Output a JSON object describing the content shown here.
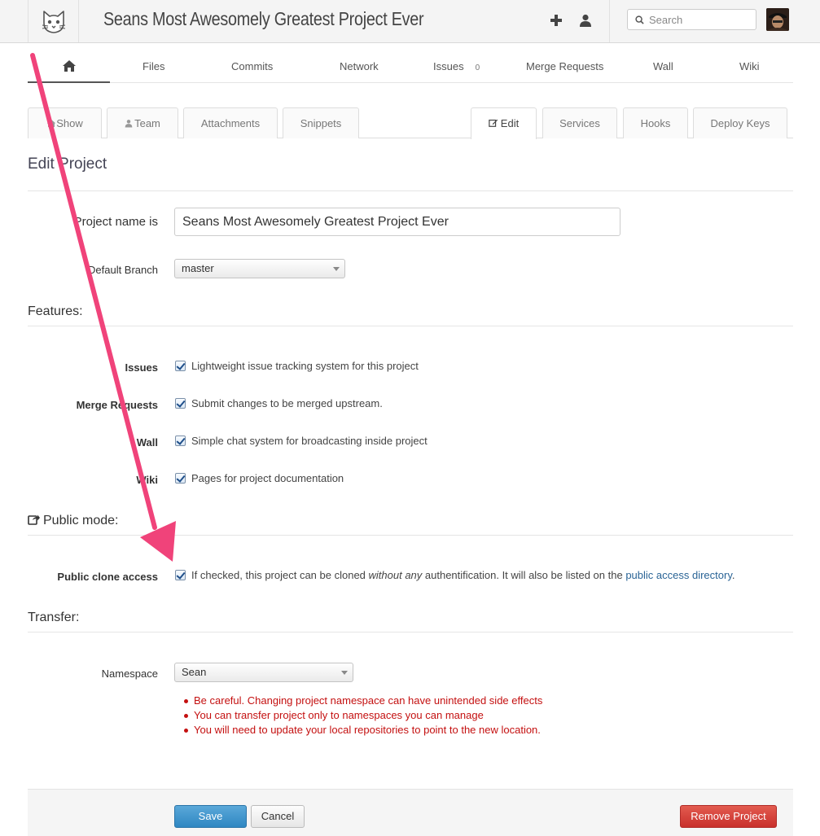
{
  "header": {
    "project_title": "Seans Most Awesomely Greatest Project Ever",
    "search_placeholder": "Search",
    "icons": [
      "gitlab-logo",
      "plus-icon",
      "user-icon",
      "search-icon",
      "avatar"
    ]
  },
  "main_nav": {
    "items": [
      {
        "label": "Files"
      },
      {
        "label": "Commits"
      },
      {
        "label": "Network"
      },
      {
        "label": "Issues",
        "count": "0"
      },
      {
        "label": "Merge Requests"
      },
      {
        "label": "Wall"
      },
      {
        "label": "Wiki"
      }
    ]
  },
  "tabs": {
    "left": [
      "Show",
      "Team",
      "Attachments",
      "Snippets"
    ],
    "right": [
      "Edit",
      "Services",
      "Hooks",
      "Deploy Keys"
    ],
    "active": "Edit"
  },
  "page": {
    "title": "Edit Project",
    "project_name_label": "Project name is",
    "project_name_value": "Seans Most Awesomely Greatest Project Ever",
    "default_branch_label": "Default Branch",
    "default_branch_value": "master"
  },
  "features": {
    "title": "Features:",
    "items": [
      {
        "label": "Issues",
        "description": "Lightweight issue tracking system for this project",
        "checked": true
      },
      {
        "label": "Merge Requests",
        "description": "Submit changes to be merged upstream.",
        "checked": true
      },
      {
        "label": "Wall",
        "description": "Simple chat system for broadcasting inside project",
        "checked": true
      },
      {
        "label": "Wiki",
        "description": "Pages for project documentation",
        "checked": true
      }
    ]
  },
  "public_mode": {
    "title": "Public mode:",
    "label": "Public clone access",
    "text_before": "If checked, this project can be cloned ",
    "text_emphasis": "without any",
    "text_after": " authentification. It will also be listed on the ",
    "link_text": "public access directory",
    "text_end": ".",
    "checked": true
  },
  "transfer": {
    "title": "Transfer:",
    "namespace_label": "Namespace",
    "namespace_value": "Sean",
    "warnings": [
      "Be careful. Changing project namespace can have unintended side effects",
      "You can transfer project only to namespaces you can manage",
      "You will need to update your local repositories to point to the new location."
    ]
  },
  "actions": {
    "save_label": "Save",
    "cancel_label": "Cancel",
    "remove_label": "Remove Project"
  },
  "colors": {
    "annotation_arrow": "#f0437a",
    "warning_text": "#c41010",
    "save_button": "#2f87c2",
    "remove_button": "#c9302c",
    "link": "#2a6496"
  }
}
